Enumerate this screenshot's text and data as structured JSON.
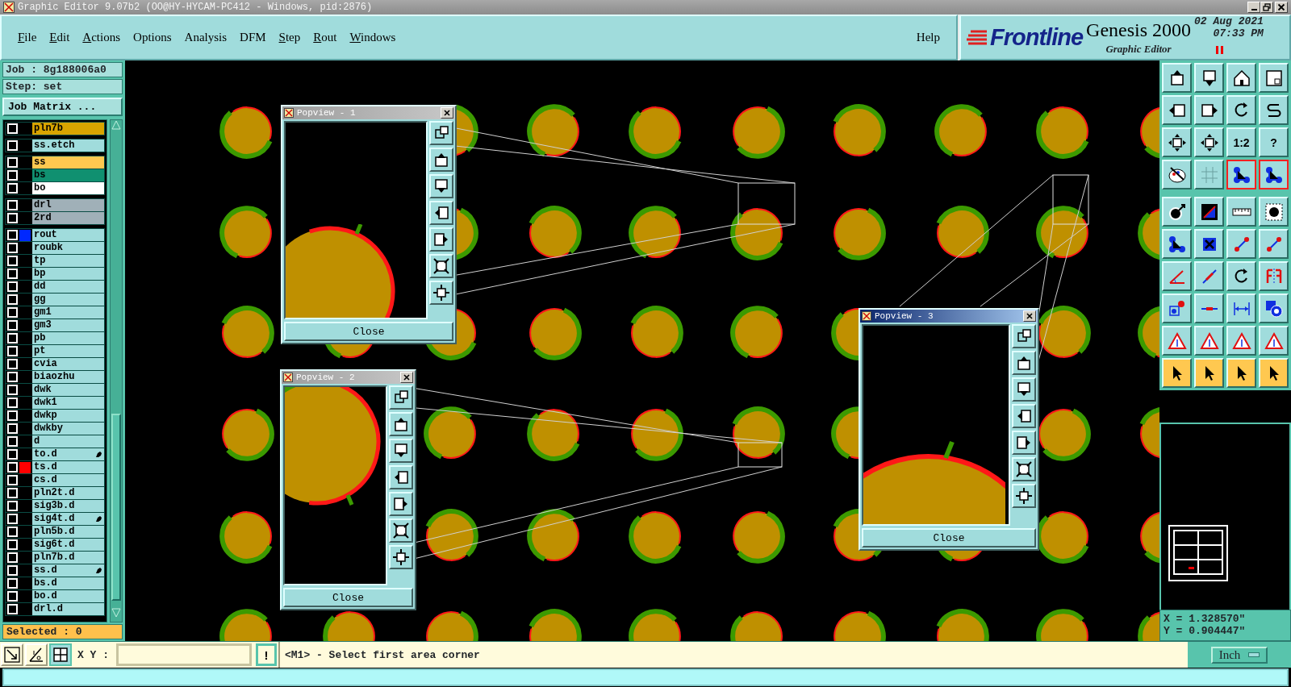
{
  "window": {
    "title": "Graphic Editor 9.07b2 (OO@HY-HYCAM-PC412 - Windows, pid:2876)"
  },
  "menu": [
    {
      "label": "File",
      "mnemonic": true
    },
    {
      "label": "Edit",
      "mnemonic": true
    },
    {
      "label": "Actions",
      "mnemonic": true
    },
    {
      "label": "Options",
      "mnemonic": false
    },
    {
      "label": "Analysis",
      "mnemonic": false
    },
    {
      "label": "DFM",
      "mnemonic": false
    },
    {
      "label": "Step",
      "mnemonic": true
    },
    {
      "label": "Rout",
      "mnemonic": true
    },
    {
      "label": "Windows",
      "mnemonic": true
    }
  ],
  "help": "Help",
  "brand": {
    "logo": "Frontline",
    "product": "Genesis 2000",
    "subtitle": "Graphic Editor",
    "date": "02 Aug 2021",
    "time": "07:33 PM"
  },
  "job": {
    "job": "Job : 8g188006a0",
    "step": "Step: set",
    "matrix_button": "Job Matrix ..."
  },
  "layer_groups": [
    {
      "layers": [
        {
          "name": "pln7b",
          "color": "#d8a400",
          "checked": false,
          "flagged": false
        }
      ]
    },
    {
      "layers": [
        {
          "name": "ss.etch",
          "color": "#a0dcdc",
          "checked": false,
          "flagged": false
        }
      ]
    },
    {
      "layers": [
        {
          "name": "ss",
          "color": "#ffc850",
          "checked": false,
          "flagged": false
        },
        {
          "name": "bs",
          "color": "#109070",
          "checked": false,
          "flagged": false
        },
        {
          "name": "bo",
          "color": "#ffffff",
          "checked": false,
          "flagged": false
        }
      ]
    },
    {
      "layers": [
        {
          "name": "drl",
          "color": "#a0b0b8",
          "checked": false,
          "flagged": false
        },
        {
          "name": "2rd",
          "color": "#a0b0b8",
          "checked": false,
          "flagged": false
        }
      ]
    },
    {
      "layers": [
        {
          "name": "rout",
          "color": "#a0dcdc",
          "marker": {
            "color": "#0028ff"
          },
          "checked": false,
          "flagged": false
        },
        {
          "name": "roubk",
          "color": "#a0dcdc",
          "checked": false,
          "flagged": false
        },
        {
          "name": "tp",
          "color": "#a0dcdc",
          "checked": false,
          "flagged": false
        },
        {
          "name": "bp",
          "color": "#a0dcdc",
          "checked": false,
          "flagged": false
        },
        {
          "name": "dd",
          "color": "#a0dcdc",
          "checked": false,
          "flagged": false
        },
        {
          "name": "gg",
          "color": "#a0dcdc",
          "checked": false,
          "flagged": false
        },
        {
          "name": "gm1",
          "color": "#a0dcdc",
          "checked": false,
          "flagged": false
        },
        {
          "name": "gm3",
          "color": "#a0dcdc",
          "checked": false,
          "flagged": false
        },
        {
          "name": "pb",
          "color": "#a0dcdc",
          "checked": false,
          "flagged": false
        },
        {
          "name": "pt",
          "color": "#a0dcdc",
          "checked": false,
          "flagged": false
        },
        {
          "name": "cvia",
          "color": "#a0dcdc",
          "checked": false,
          "flagged": false
        },
        {
          "name": "biaozhu",
          "color": "#a0dcdc",
          "checked": false,
          "flagged": false
        },
        {
          "name": "dwk",
          "color": "#a0dcdc",
          "checked": false,
          "flagged": false
        },
        {
          "name": "dwk1",
          "color": "#a0dcdc",
          "checked": false,
          "flagged": false
        },
        {
          "name": "dwkp",
          "color": "#a0dcdc",
          "checked": false,
          "flagged": false
        },
        {
          "name": "dwkby",
          "color": "#a0dcdc",
          "checked": false,
          "flagged": false
        },
        {
          "name": "d",
          "color": "#a0dcdc",
          "checked": false,
          "flagged": false
        },
        {
          "name": "to.d",
          "color": "#a0dcdc",
          "checked": false,
          "flagged": true
        },
        {
          "name": "ts.d",
          "color": "#a0dcdc",
          "marker": {
            "color": "#ff0000"
          },
          "checked": false,
          "flagged": false
        },
        {
          "name": "cs.d",
          "color": "#a0dcdc",
          "checked": false,
          "flagged": false
        },
        {
          "name": "pln2t.d",
          "color": "#a0dcdc",
          "checked": false,
          "flagged": false
        },
        {
          "name": "sig3b.d",
          "color": "#a0dcdc",
          "checked": false,
          "flagged": false
        },
        {
          "name": "sig4t.d",
          "color": "#a0dcdc",
          "checked": false,
          "flagged": true
        },
        {
          "name": "pln5b.d",
          "color": "#a0dcdc",
          "checked": false,
          "flagged": false
        },
        {
          "name": "sig6t.d",
          "color": "#a0dcdc",
          "checked": false,
          "flagged": false
        },
        {
          "name": "pln7b.d",
          "color": "#a0dcdc",
          "checked": false,
          "flagged": false
        },
        {
          "name": "ss.d",
          "color": "#a0dcdc",
          "checked": false,
          "flagged": true
        },
        {
          "name": "bs.d",
          "color": "#a0dcdc",
          "checked": false,
          "flagged": false
        },
        {
          "name": "bo.d",
          "color": "#a0dcdc",
          "checked": false,
          "flagged": false
        },
        {
          "name": "drl.d",
          "color": "#a0dcdc",
          "checked": false,
          "flagged": false
        }
      ]
    }
  ],
  "selected_count": "Selected : 0",
  "popviews": [
    {
      "title": "Popview - 1",
      "active": false,
      "close": "Close"
    },
    {
      "title": "Popview - 2",
      "active": false,
      "close": "Close"
    },
    {
      "title": "Popview - 3",
      "active": true,
      "close": "Close"
    }
  ],
  "tools": [
    {
      "kind": "box-up",
      "on": false
    },
    {
      "kind": "box-down",
      "on": false
    },
    {
      "kind": "home",
      "on": false
    },
    {
      "kind": "frame",
      "on": false
    },
    {
      "kind": "box-left",
      "on": false
    },
    {
      "kind": "box-right",
      "on": false
    },
    {
      "kind": "rotate",
      "on": false
    },
    {
      "kind": "s-curve",
      "on": false
    },
    {
      "kind": "expand",
      "on": false
    },
    {
      "kind": "expand",
      "on": false
    },
    {
      "kind": "label",
      "label": "1:2",
      "on": false
    },
    {
      "kind": "label",
      "label": "?",
      "on": false
    },
    {
      "kind": "palette",
      "on": false
    },
    {
      "kind": "grid",
      "on": false
    },
    {
      "kind": "nodes",
      "on": true
    },
    {
      "kind": "nodes",
      "on": true
    },
    {
      "kind": "circle-arrow",
      "on": false
    },
    {
      "kind": "corner",
      "on": false
    },
    {
      "kind": "ruler",
      "on": false
    },
    {
      "kind": "dotted-circle",
      "on": false
    },
    {
      "kind": "nodes",
      "on": false
    },
    {
      "kind": "cross",
      "on": false
    },
    {
      "kind": "dot-line",
      "on": false
    },
    {
      "kind": "dot-line",
      "on": false
    },
    {
      "kind": "angle",
      "on": false
    },
    {
      "kind": "slash",
      "on": false
    },
    {
      "kind": "rotate",
      "on": false
    },
    {
      "kind": "mirror",
      "on": false
    },
    {
      "kind": "dot-box",
      "on": false
    },
    {
      "kind": "dash",
      "on": false
    },
    {
      "kind": "dimension",
      "on": false
    },
    {
      "kind": "shapes",
      "on": false
    },
    {
      "kind": "triangle",
      "on": false
    },
    {
      "kind": "triangle",
      "on": false
    },
    {
      "kind": "triangle",
      "on": false
    },
    {
      "kind": "triangle",
      "on": false
    },
    {
      "kind": "pointer",
      "on": false
    },
    {
      "kind": "pointer",
      "on": false
    },
    {
      "kind": "pointer",
      "on": false
    },
    {
      "kind": "pointer",
      "on": false
    }
  ],
  "coords": {
    "x": "X = 1.328570\"",
    "y": "Y = 0.904447\""
  },
  "command": {
    "xy_label": "X Y :",
    "alert": "!",
    "message": "<M1> - Select first area corner",
    "units": "Inch"
  }
}
